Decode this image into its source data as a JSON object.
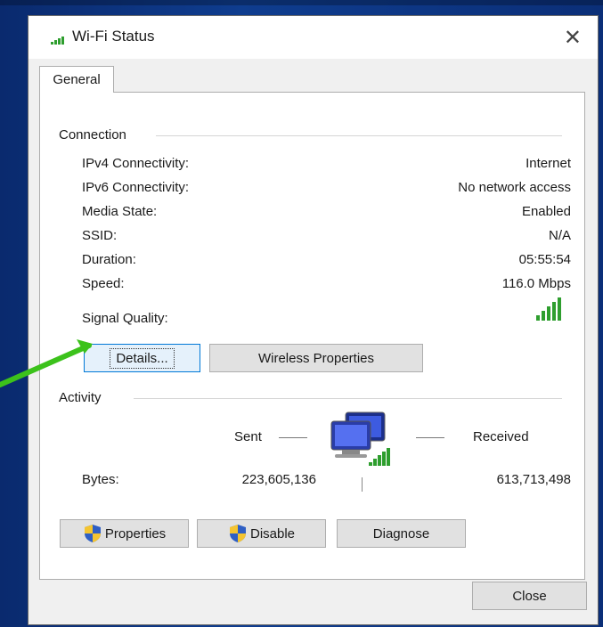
{
  "window": {
    "title": "Wi-Fi Status",
    "close_glyph": "✕"
  },
  "tabs": [
    {
      "label": "General",
      "active": true
    }
  ],
  "connection": {
    "heading": "Connection",
    "rows": [
      {
        "label": "IPv4 Connectivity:",
        "value": "Internet"
      },
      {
        "label": "IPv6 Connectivity:",
        "value": "No network access"
      },
      {
        "label": "Media State:",
        "value": "Enabled"
      },
      {
        "label": "SSID:",
        "value": "N/A"
      },
      {
        "label": "Duration:",
        "value": "05:55:54"
      },
      {
        "label": "Speed:",
        "value": "116.0 Mbps"
      }
    ],
    "signal_label": "Signal Quality:",
    "signal_bars_active": 5,
    "signal_bars_total": 5,
    "details_button": "Details...",
    "wireless_properties_button": "Wireless Properties"
  },
  "activity": {
    "heading": "Activity",
    "sent_label": "Sent",
    "received_label": "Received",
    "bytes_label": "Bytes:",
    "bytes_sent": "223,605,136",
    "bytes_received": "613,713,498"
  },
  "buttons": {
    "properties": "Properties",
    "disable": "Disable",
    "diagnose": "Diagnose",
    "close": "Close"
  },
  "colors": {
    "signal_green": "#2e9e2e",
    "arrow_green": "#3cc21b",
    "focus_blue": "#0078d7"
  }
}
